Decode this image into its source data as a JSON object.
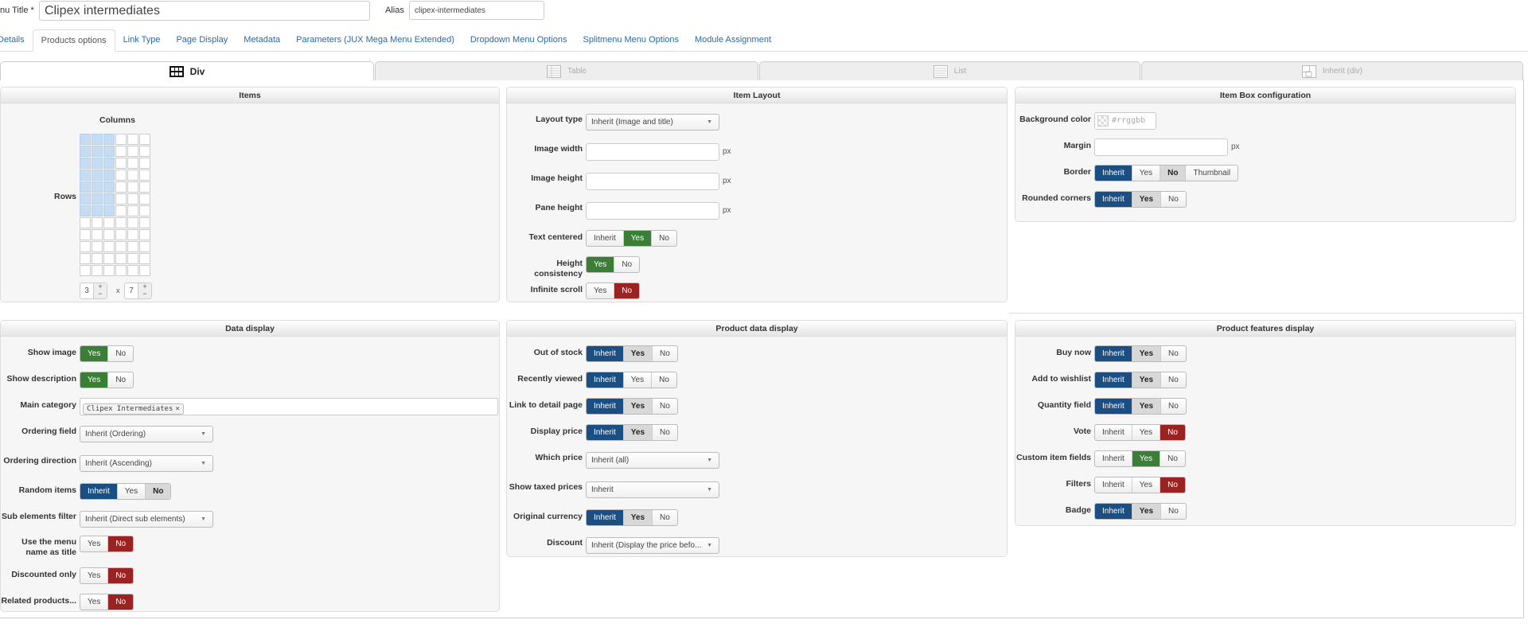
{
  "header": {
    "menu_title_label": "nu Title *",
    "menu_title_value": "Clipex intermediates",
    "alias_label": "Alias",
    "alias_value": "clipex-intermediates"
  },
  "nav_tabs": [
    {
      "label": "Details"
    },
    {
      "label": "Products options",
      "active": true
    },
    {
      "label": "Link Type"
    },
    {
      "label": "Page Display"
    },
    {
      "label": "Metadata"
    },
    {
      "label": "Parameters (JUX Mega Menu Extended)"
    },
    {
      "label": "Dropdown Menu Options"
    },
    {
      "label": "Splitmenu Menu Options"
    },
    {
      "label": "Module Assignment"
    }
  ],
  "layout_tabs": [
    {
      "label": "Div",
      "icon": "div-grid-icon",
      "active": true
    },
    {
      "label": "Table",
      "icon": "table-icon"
    },
    {
      "label": "List",
      "icon": "list-icon"
    },
    {
      "label": "Inherit (div)",
      "icon": "inherit-icon"
    }
  ],
  "colors": {
    "inherit": "#1b4e82",
    "yes": "#3a7f35",
    "no": "#9a2322",
    "grid_selected": "#c6dcf2"
  },
  "items": {
    "title": "Items",
    "columns_label": "Columns",
    "rows_label": "Rows",
    "grid_total_columns": 6,
    "grid_total_rows": 12,
    "columns": "3",
    "rows": "7",
    "times": "x",
    "plus": "+",
    "minus": "−"
  },
  "panels": {
    "item_layout": {
      "title": "Item Layout",
      "rows": [
        {
          "type": "select",
          "label": "Layout type",
          "value": "Inherit (Image and title)"
        },
        {
          "type": "text",
          "label": "Image width",
          "unit": "px"
        },
        {
          "type": "text",
          "label": "Image height",
          "unit": "px"
        },
        {
          "type": "text",
          "label": "Pane height",
          "unit": "px"
        },
        {
          "type": "toggle",
          "label": "Text centered",
          "options": [
            "Inherit",
            "Yes",
            "No"
          ],
          "active": 1
        },
        {
          "type": "toggle",
          "label": "Height consistency",
          "options": [
            "Yes",
            "No"
          ],
          "active": 0
        },
        {
          "type": "toggle",
          "label": "Infinite scroll",
          "options": [
            "Yes",
            "No"
          ],
          "active": 1
        }
      ]
    },
    "item_box": {
      "title": "Item Box configuration",
      "rows": [
        {
          "type": "color",
          "label": "Background color",
          "placeholder": "#rrggbb"
        },
        {
          "type": "text",
          "label": "Margin",
          "unit": "px"
        },
        {
          "type": "toggle",
          "label": "Border",
          "options": [
            "Inherit",
            "Yes",
            "No",
            "Thumbnail"
          ],
          "active": 0,
          "inherited": 2
        },
        {
          "type": "toggle",
          "label": "Rounded corners",
          "options": [
            "Inherit",
            "Yes",
            "No"
          ],
          "active": 0,
          "inherited": 1
        }
      ]
    },
    "data_display": {
      "title": "Data display",
      "rows": [
        {
          "type": "toggle",
          "label": "Show image",
          "options": [
            "Yes",
            "No"
          ],
          "active": 0
        },
        {
          "type": "toggle",
          "label": "Show description",
          "options": [
            "Yes",
            "No"
          ],
          "active": 0
        },
        {
          "type": "tags",
          "label": "Main category",
          "tags": [
            "Clipex Intermediates"
          ]
        },
        {
          "type": "select",
          "label": "Ordering field",
          "value": "Inherit (Ordering)"
        },
        {
          "type": "select",
          "label": "Ordering direction",
          "value": "Inherit (Ascending)"
        },
        {
          "type": "toggle",
          "label": "Random items",
          "options": [
            "Inherit",
            "Yes",
            "No"
          ],
          "active": 0,
          "inherited": 2
        },
        {
          "type": "select",
          "label": "Sub elements filter",
          "value": "Inherit (Direct sub elements)"
        },
        {
          "type": "toggle",
          "label": "Use the menu name as title",
          "options": [
            "Yes",
            "No"
          ],
          "active": 1,
          "two_line": true
        },
        {
          "type": "toggle",
          "label": "Discounted only",
          "options": [
            "Yes",
            "No"
          ],
          "active": 1
        },
        {
          "type": "toggle",
          "label": "Related products...",
          "options": [
            "Yes",
            "No"
          ],
          "active": 1
        }
      ]
    },
    "product_data": {
      "title": "Product data display",
      "rows": [
        {
          "type": "toggle",
          "label": "Out of stock",
          "options": [
            "Inherit",
            "Yes",
            "No"
          ],
          "active": 0,
          "inherited": 1
        },
        {
          "type": "toggle",
          "label": "Recently viewed",
          "options": [
            "Inherit",
            "Yes",
            "No"
          ],
          "active": 0
        },
        {
          "type": "toggle",
          "label": "Link to detail page",
          "options": [
            "Inherit",
            "Yes",
            "No"
          ],
          "active": 0,
          "inherited": 1
        },
        {
          "type": "toggle",
          "label": "Display price",
          "options": [
            "Inherit",
            "Yes",
            "No"
          ],
          "active": 0,
          "inherited": 1
        },
        {
          "type": "select",
          "label": "Which price",
          "value": "Inherit (all)"
        },
        {
          "type": "select",
          "label": "Show taxed prices",
          "value": "Inherit"
        },
        {
          "type": "toggle",
          "label": "Original currency",
          "options": [
            "Inherit",
            "Yes",
            "No"
          ],
          "active": 0,
          "inherited": 1
        },
        {
          "type": "select",
          "label": "Discount",
          "value": "Inherit (Display the price befo..."
        }
      ]
    },
    "product_features": {
      "title": "Product features display",
      "rows": [
        {
          "type": "toggle",
          "label": "Buy now",
          "options": [
            "Inherit",
            "Yes",
            "No"
          ],
          "active": 0,
          "inherited": 1
        },
        {
          "type": "toggle",
          "label": "Add to wishlist",
          "options": [
            "Inherit",
            "Yes",
            "No"
          ],
          "active": 0,
          "inherited": 1
        },
        {
          "type": "toggle",
          "label": "Quantity field",
          "options": [
            "Inherit",
            "Yes",
            "No"
          ],
          "active": 0,
          "inherited": 1
        },
        {
          "type": "toggle",
          "label": "Vote",
          "options": [
            "Inherit",
            "Yes",
            "No"
          ],
          "active": 2
        },
        {
          "type": "toggle",
          "label": "Custom item fields",
          "options": [
            "Inherit",
            "Yes",
            "No"
          ],
          "active": 1
        },
        {
          "type": "toggle",
          "label": "Filters",
          "options": [
            "Inherit",
            "Yes",
            "No"
          ],
          "active": 2
        },
        {
          "type": "toggle",
          "label": "Badge",
          "options": [
            "Inherit",
            "Yes",
            "No"
          ],
          "active": 0,
          "inherited": 1
        }
      ]
    }
  }
}
